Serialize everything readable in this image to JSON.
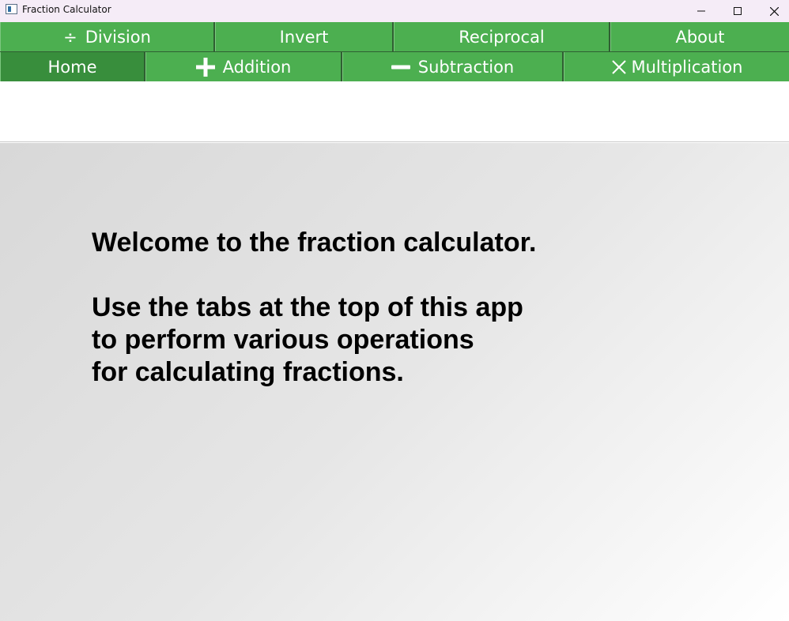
{
  "window": {
    "title": "Fraction Calculator",
    "icon": "app-window-icon",
    "controls": [
      "minimize-icon",
      "maximize-icon",
      "close-icon"
    ]
  },
  "tabs": {
    "row1": [
      {
        "label": "Division",
        "glyph": "÷",
        "icon": "divide-icon"
      },
      {
        "label": "Invert"
      },
      {
        "label": "Reciprocal"
      },
      {
        "label": "About"
      }
    ],
    "row2": [
      {
        "label": "Home",
        "selected": true
      },
      {
        "label": "Addition",
        "icon": "plus-icon"
      },
      {
        "label": "Subtraction",
        "icon": "minus-icon"
      },
      {
        "label": "Multiplication",
        "icon": "multiply-icon"
      }
    ]
  },
  "home": {
    "line1": "Welcome to the fraction calculator.",
    "line2": "Use the tabs at the top of this app",
    "line3": "to perform various operations",
    "line4": "for calculating fractions."
  },
  "colors": {
    "tab": "#4caf50",
    "tab_selected": "#388e3c",
    "titlebar": "#f5ecf7"
  }
}
